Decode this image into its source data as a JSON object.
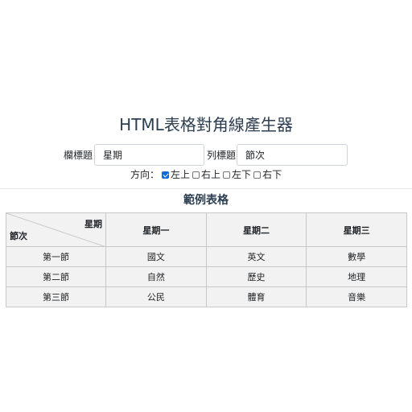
{
  "title": "HTML表格對角線產生器",
  "fields": {
    "col_header_label": "欄標題",
    "col_header_value": "星期",
    "row_header_label": "列標題",
    "row_header_value": "節次"
  },
  "direction": {
    "label": "方向：",
    "options": [
      {
        "label": "左上",
        "checked": true
      },
      {
        "label": "右上",
        "checked": false
      },
      {
        "label": "左下",
        "checked": false
      },
      {
        "label": "右下",
        "checked": false
      }
    ]
  },
  "example": {
    "title": "範例表格",
    "corner_top": "星期",
    "corner_bottom": "節次",
    "columns": [
      "星期一",
      "星期二",
      "星期三"
    ],
    "rows": [
      {
        "label": "第一節",
        "cells": [
          "國文",
          "英文",
          "數學"
        ]
      },
      {
        "label": "第二節",
        "cells": [
          "自然",
          "歷史",
          "地理"
        ]
      },
      {
        "label": "第三節",
        "cells": [
          "公民",
          "體育",
          "音樂"
        ]
      }
    ]
  }
}
